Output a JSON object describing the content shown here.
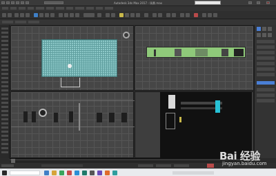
{
  "window": {
    "title": "Autodesk 3ds Max 2017 - 场景.max",
    "search_placeholder": ""
  },
  "viewports": {
    "top": {
      "label": ""
    },
    "front": {
      "label": ""
    },
    "left": {
      "label": ""
    },
    "perspective": {
      "label": ""
    }
  },
  "watermark": {
    "brand": "Bai 经验",
    "url": "jingyan.baidu.com"
  },
  "colors": {
    "background": "#2b2b2b",
    "viewport": "#464646",
    "grid": "#555555",
    "plan_cyan": "#8ec9c9",
    "plan_green": "#8fc97a",
    "screen_cyan": "#27c2d6",
    "selection_blue": "#4a7fd6"
  },
  "icons": [
    "windows-start-icon",
    "search-icon",
    "viewcube-icon",
    "screen-cyan-icon"
  ]
}
